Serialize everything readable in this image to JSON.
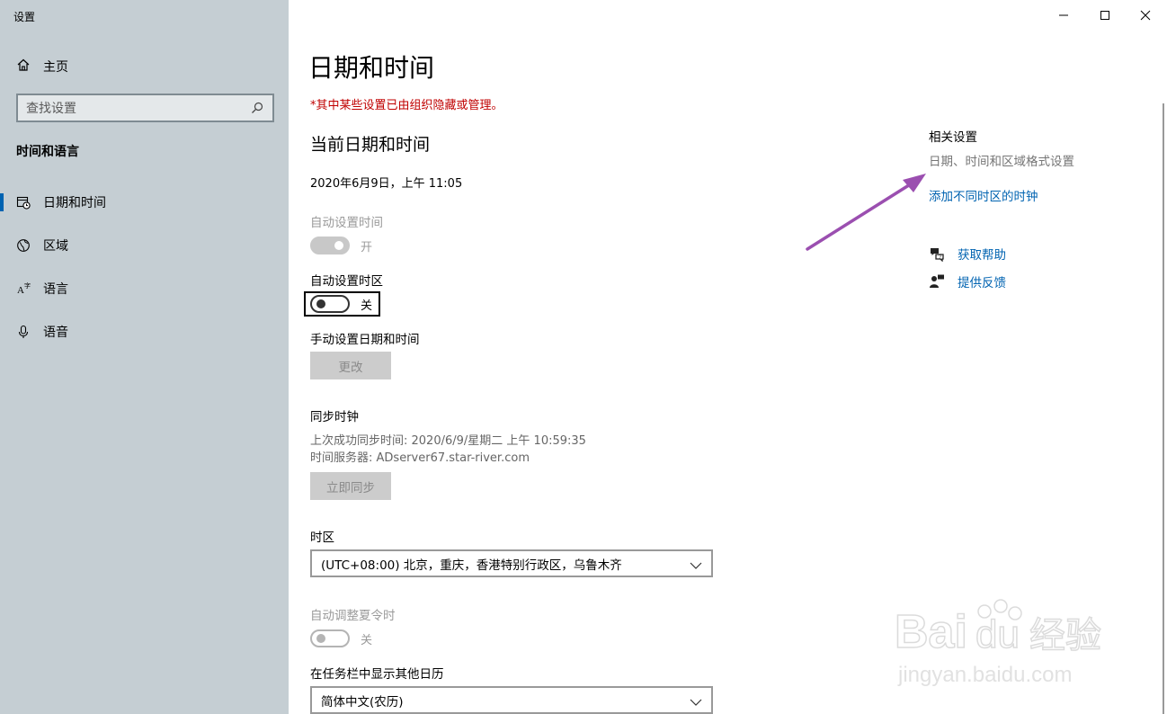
{
  "window": {
    "title": "设置",
    "controls": [
      "minimize-icon",
      "maximize-icon",
      "close-icon"
    ]
  },
  "sidebar": {
    "home": "主页",
    "search_placeholder": "查找设置",
    "section": "时间和语言",
    "items": [
      {
        "label": "日期和时间",
        "icon": "calendar-clock-icon",
        "active": true
      },
      {
        "label": "区域",
        "icon": "globe-icon",
        "active": false
      },
      {
        "label": "语言",
        "icon": "language-icon",
        "active": false
      },
      {
        "label": "语音",
        "icon": "microphone-icon",
        "active": false
      }
    ]
  },
  "main": {
    "title": "日期和时间",
    "managed_note": "*其中某些设置已由组织隐藏或管理。",
    "current_heading": "当前日期和时间",
    "current_datetime": "2020年6月9日，上午 11:05",
    "auto_time": {
      "label": "自动设置时间",
      "state": "开",
      "on": true,
      "disabled": true
    },
    "auto_timezone": {
      "label": "自动设置时区",
      "state": "关",
      "on": false,
      "disabled": false
    },
    "manual": {
      "label": "手动设置日期和时间",
      "button": "更改"
    },
    "sync": {
      "heading": "同步时钟",
      "last_sync": "上次成功同步时间: 2020/6/9/星期二 上午 10:59:35",
      "server": "时间服务器: ADserver67.star-river.com",
      "button": "立即同步"
    },
    "timezone": {
      "label": "时区",
      "value": "(UTC+08:00) 北京，重庆，香港特别行政区，乌鲁木齐"
    },
    "dst": {
      "label": "自动调整夏令时",
      "state": "关",
      "on": false,
      "disabled": true
    },
    "calendar": {
      "label": "在任务栏中显示其他日历",
      "value": "简体中文(农历)"
    }
  },
  "related": {
    "title": "相关设置",
    "region_format": "日期、时间和区域格式设置",
    "add_clocks": "添加不同时区的时钟",
    "help": "获取帮助",
    "feedback": "提供反馈"
  },
  "watermark": {
    "brand": "Baidu经验",
    "url": "jingyan.baidu.com"
  },
  "colors": {
    "accent": "#0063b1",
    "warning": "#c00000",
    "arrow": "#9b4fb0",
    "sidebar": "#c5ced3"
  }
}
